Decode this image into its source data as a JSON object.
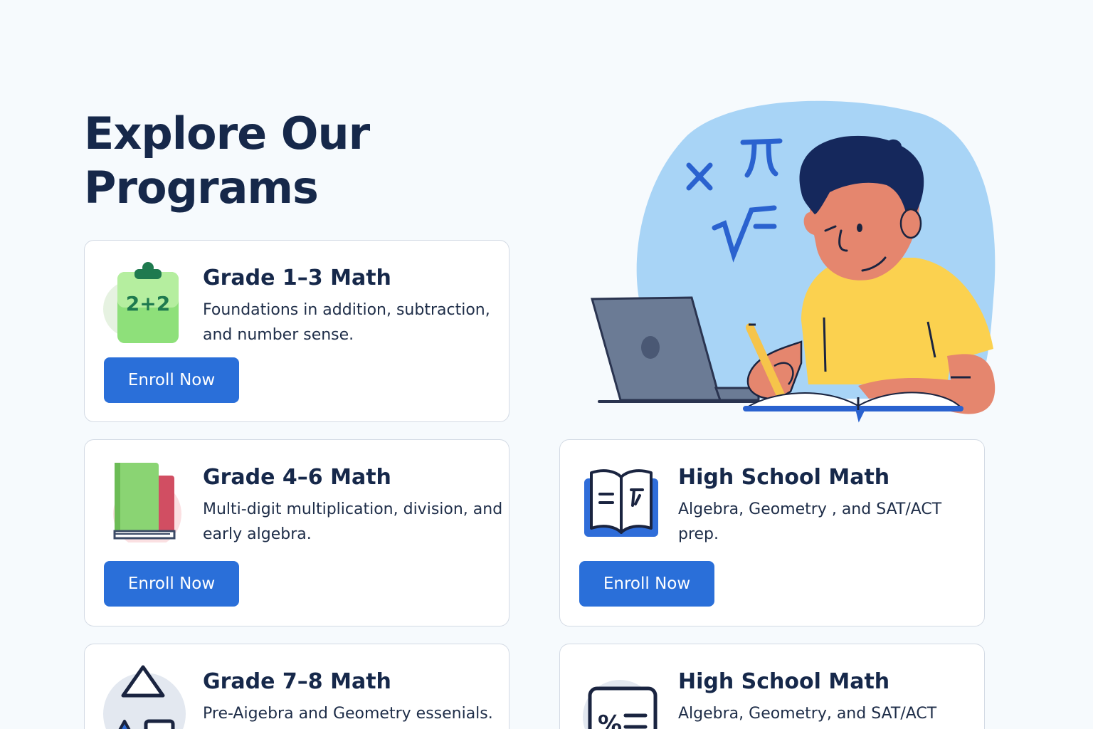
{
  "page": {
    "title": "Explore Our Programs"
  },
  "programs": [
    {
      "title": "Grade 1–3 Math",
      "description": "Foundations in addition, subtraction, and number sense.",
      "icon": "clipboard-addition-icon",
      "icon_text": "2+2",
      "button_label": "Enroll Now"
    },
    {
      "title": "Grade 4–6 Math",
      "description": "Multi-digit multiplication, division, and early algebra.",
      "icon": "books-icon",
      "button_label": "Enroll Now"
    },
    {
      "title": "High School Math",
      "description": "Algebra, Geometry , and SAT/ACT prep.",
      "icon": "open-book-icon",
      "button_label": "Enroll Now"
    },
    {
      "title": "Grade 7–8 Math",
      "description": "Pre-Aigebra and Geometry essenials.",
      "icon": "shapes-icon"
    },
    {
      "title": "High School Math",
      "description": "Algebra, Geometry, and SAT/ACT",
      "icon": "calculator-percent-icon"
    }
  ],
  "hero": {
    "illustration": "student-studying-illustration",
    "symbols": [
      "×",
      "π",
      "√"
    ]
  },
  "colors": {
    "heading": "#16284a",
    "button": "#2a6fd9",
    "background": "#f6fafd",
    "card_border": "#d3dae4",
    "hero_blob": "#a8d4f6",
    "shirt": "#fbd14f"
  }
}
